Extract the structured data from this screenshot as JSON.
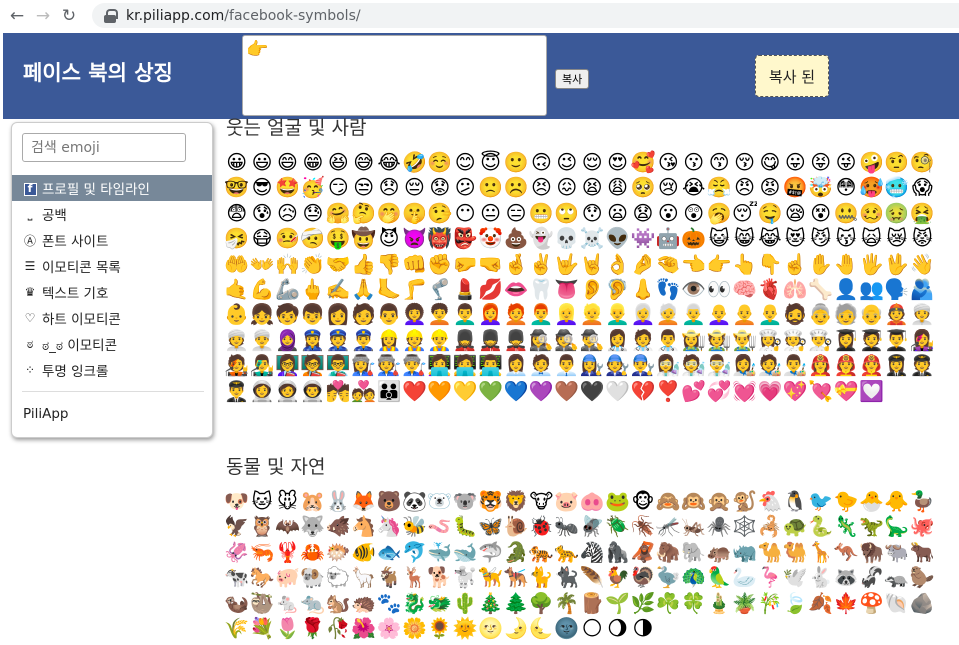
{
  "browser": {
    "url_host": "kr.piliapp.com",
    "url_path": "/facebook-symbols/",
    "back_icon": "back-arrow-icon",
    "forward_icon": "forward-arrow-icon",
    "reload_icon": "reload-icon"
  },
  "header": {
    "title": "페이스 북의 상징",
    "copy_area_value": "👉",
    "copy_button": "복사",
    "copied_label": "복사 된",
    "bg_color": "#3b5998"
  },
  "sidebar": {
    "search_placeholder": "검색 emoji",
    "items": [
      {
        "icon": "f",
        "label": "프로필 및 타임라인",
        "active": true
      },
      {
        "icon": "⎵",
        "label": "공백"
      },
      {
        "icon": "Ⓐ",
        "label": "폰트 사이트"
      },
      {
        "icon": "☰",
        "label": "이모티콘 목록"
      },
      {
        "icon": "♛",
        "label": "텍스트 기호"
      },
      {
        "icon": "♡",
        "label": "하트 이모티콘"
      },
      {
        "icon": "ಠ",
        "label": "ಠ_ಠ 이모티콘"
      },
      {
        "icon": "⁘",
        "label": "투명 잉크롤"
      }
    ],
    "footer": "PiliApp"
  },
  "sections": [
    {
      "title": "웃는 얼굴 및 사람",
      "emojis": [
        "😀",
        "😃",
        "😄",
        "😁",
        "😆",
        "😅",
        "😂",
        "🤣",
        "☺️",
        "😊",
        "😇",
        "🙂",
        "🙃",
        "😉",
        "😌",
        "😍",
        "🥰",
        "😘",
        "😗",
        "😙",
        "😚",
        "😋",
        "😛",
        "😝",
        "😜",
        "🤪",
        "🤨",
        "🧐",
        "🤓",
        "😎",
        "🤩",
        "🥳",
        "😏",
        "😒",
        "😞",
        "😔",
        "😟",
        "😕",
        "🙁",
        "☹️",
        "😣",
        "😖",
        "😫",
        "😩",
        "🥺",
        "😢",
        "😭",
        "😤",
        "😠",
        "😡",
        "🤬",
        "🤯",
        "😳",
        "🥵",
        "🥶",
        "😱",
        "😨",
        "😰",
        "😥",
        "😓",
        "🤗",
        "🤔",
        "🤭",
        "🤫",
        "🤥",
        "😶",
        "😐",
        "😑",
        "😬",
        "🙄",
        "😯",
        "😦",
        "😧",
        "😮",
        "😲",
        "🥱",
        "😴",
        "🤤",
        "😪",
        "😵",
        "🤐",
        "🥴",
        "🤢",
        "🤮",
        "🤧",
        "😷",
        "🤒",
        "🤕",
        "🤑",
        "🤠",
        "😈",
        "👿",
        "👹",
        "👺",
        "🤡",
        "💩",
        "👻",
        "💀",
        "☠️",
        "👽",
        "👾",
        "🤖",
        "🎃",
        "😺",
        "😸",
        "😹",
        "😻",
        "😼",
        "😽",
        "🙀",
        "😿",
        "😾",
        "🤲",
        "👐",
        "🙌",
        "👏",
        "🤝",
        "👍",
        "👎",
        "👊",
        "✊",
        "🤛",
        "🤜",
        "🤞",
        "✌️",
        "🤟",
        "🤘",
        "👌",
        "🤌",
        "🤏",
        "👈",
        "👉",
        "👆",
        "👇",
        "☝️",
        "✋",
        "🤚",
        "🖐️",
        "🖖",
        "👋",
        "🤙",
        "💪",
        "🦾",
        "🖕",
        "✍️",
        "🙏",
        "🦶",
        "🦵",
        "🦿",
        "💄",
        "💋",
        "👄",
        "🦷",
        "👅",
        "👂",
        "🦻",
        "👃",
        "👣",
        "👁️",
        "👀",
        "🧠",
        "🫀",
        "🫁",
        "🦴",
        "👤",
        "👥",
        "🗣️",
        "🫂",
        "👶",
        "👧",
        "🧒",
        "👦",
        "👩",
        "🧑",
        "👨",
        "👩‍🦱",
        "🧑‍🦱",
        "👨‍🦱",
        "👩‍🦰",
        "🧑‍🦰",
        "👨‍🦰",
        "👱‍♀️",
        "👱",
        "👱‍♂️",
        "👩‍🦳",
        "🧑‍🦳",
        "👨‍🦳",
        "👩‍🦲",
        "🧑‍🦲",
        "👨‍🦲",
        "🧔",
        "👵",
        "🧓",
        "👴",
        "👲",
        "👳‍♀️",
        "👳",
        "👳‍♂️",
        "🧕",
        "👮‍♀️",
        "👮",
        "👮‍♂️",
        "👷‍♀️",
        "👷",
        "👷‍♂️",
        "💂‍♀️",
        "💂",
        "💂‍♂️",
        "🕵️‍♀️",
        "🕵️",
        "🕵️‍♂️",
        "👩‍⚕️",
        "🧑‍⚕️",
        "👨‍⚕️",
        "👩‍🌾",
        "🧑‍🌾",
        "👨‍🌾",
        "👩‍🍳",
        "🧑‍🍳",
        "👨‍🍳",
        "👩‍🎓",
        "🧑‍🎓",
        "👨‍🎓",
        "👩‍🎤",
        "🧑‍🎤",
        "👨‍🎤",
        "👩‍🏫",
        "🧑‍🏫",
        "👨‍🏫",
        "👩‍🏭",
        "🧑‍🏭",
        "👨‍🏭",
        "👩‍💻",
        "🧑‍💻",
        "👨‍💻",
        "👩‍💼",
        "🧑‍💼",
        "👨‍💼",
        "👩‍🔧",
        "🧑‍🔧",
        "👨‍🔧",
        "👩‍🔬",
        "🧑‍🔬",
        "👨‍🔬",
        "👩‍🎨",
        "🧑‍🎨",
        "👨‍🎨",
        "👩‍🚒",
        "🧑‍🚒",
        "👨‍🚒",
        "👩‍✈️",
        "🧑‍✈️",
        "👨‍✈️",
        "👩‍🚀",
        "🧑‍🚀",
        "👨‍🚀",
        "💏",
        "💑",
        "👪",
        "❤️",
        "🧡",
        "💛",
        "💚",
        "💙",
        "💜",
        "🤎",
        "🖤",
        "🤍",
        "💔",
        "❣️",
        "💕",
        "💞",
        "💓",
        "💗",
        "💖",
        "💘",
        "💝",
        "💟"
      ]
    },
    {
      "title": "동물 및 자연",
      "emojis": [
        "🐶",
        "🐱",
        "🐭",
        "🐹",
        "🐰",
        "🦊",
        "🐻",
        "🐼",
        "🐻‍❄️",
        "🐨",
        "🐯",
        "🦁",
        "🐮",
        "🐷",
        "🐽",
        "🐸",
        "🐵",
        "🙈",
        "🙉",
        "🙊",
        "🐒",
        "🐔",
        "🐧",
        "🐦",
        "🐤",
        "🐣",
        "🐥",
        "🦆",
        "🦅",
        "🦉",
        "🦇",
        "🐺",
        "🐗",
        "🐴",
        "🦄",
        "🐝",
        "🪱",
        "🐛",
        "🦋",
        "🐌",
        "🐞",
        "🐜",
        "🪰",
        "🪲",
        "🪳",
        "🦟",
        "🦗",
        "🕷️",
        "🕸️",
        "🦂",
        "🐢",
        "🐍",
        "🦎",
        "🦖",
        "🦕",
        "🐙",
        "🦑",
        "🦐",
        "🦞",
        "🦀",
        "🐡",
        "🐠",
        "🐟",
        "🐬",
        "🐳",
        "🐋",
        "🦈",
        "🐊",
        "🐅",
        "🐆",
        "🦓",
        "🦍",
        "🦧",
        "🦣",
        "🐘",
        "🦛",
        "🦏",
        "🐪",
        "🐫",
        "🦒",
        "🦘",
        "🦬",
        "🐃",
        "🐂",
        "🐄",
        "🐎",
        "🐖",
        "🐏",
        "🐑",
        "🦙",
        "🐐",
        "🦌",
        "🐕",
        "🐩",
        "🦮",
        "🐕‍🦺",
        "🐈",
        "🐈‍⬛",
        "🪶",
        "🐓",
        "🦃",
        "🦤",
        "🦚",
        "🦜",
        "🦢",
        "🦩",
        "🕊️",
        "🐇",
        "🦝",
        "🦨",
        "🦡",
        "🦫",
        "🦦",
        "🦥",
        "🐁",
        "🐀",
        "🐿️",
        "🦔",
        "🐾",
        "🐉",
        "🐲",
        "🌵",
        "🎄",
        "🌲",
        "🌳",
        "🌴",
        "🪵",
        "🌱",
        "🌿",
        "☘️",
        "🍀",
        "🎍",
        "🪴",
        "🎋",
        "🍃",
        "🍂",
        "🍁",
        "🍄",
        "🐚",
        "🪨",
        "🌾",
        "💐",
        "🌷",
        "🌹",
        "🥀",
        "🌺",
        "🌸",
        "🌼",
        "🌻",
        "🌞",
        "🌝",
        "🌛",
        "🌜",
        "🌚",
        "🌕",
        "🌖",
        "🌗"
      ]
    }
  ]
}
